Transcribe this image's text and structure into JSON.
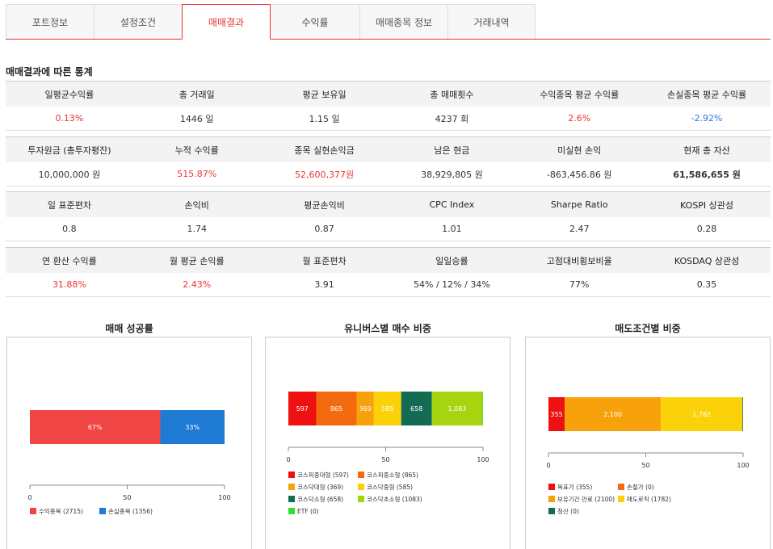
{
  "tabs": [
    {
      "label": "포트정보",
      "active": false
    },
    {
      "label": "설정조건",
      "active": false
    },
    {
      "label": "매매결과",
      "active": true
    },
    {
      "label": "수익률",
      "active": false
    },
    {
      "label": "매매종목 정보",
      "active": false
    },
    {
      "label": "거래내역",
      "active": false
    }
  ],
  "section_title": "매매결과에 따른 통계",
  "stats": [
    {
      "headers": [
        "일평균수익률",
        "총 거래일",
        "평균 보유일",
        "총 매매횟수",
        "수익종목 평균 수익률",
        "손실종목 평균 수익률"
      ],
      "values": [
        {
          "text": "0.13%",
          "color": "red"
        },
        {
          "text": "1446 일",
          "color": ""
        },
        {
          "text": "1.15 일",
          "color": ""
        },
        {
          "text": "4237 회",
          "color": ""
        },
        {
          "text": "2.6%",
          "color": "red"
        },
        {
          "text": "-2.92%",
          "color": "blue"
        }
      ]
    },
    {
      "headers": [
        "투자원금 (총투자평잔)",
        "누적 수익률",
        "종목 실현손익금",
        "남은 현금",
        "미실현 손익",
        "현재 총 자산"
      ],
      "values": [
        {
          "text": "10,000,000 원",
          "color": ""
        },
        {
          "text": "515.87%",
          "color": "red"
        },
        {
          "text": "52,600,377원",
          "color": "red"
        },
        {
          "text": "38,929,805 원",
          "color": ""
        },
        {
          "text": "-863,456.86 원",
          "color": ""
        },
        {
          "text": "61,586,655 원",
          "color": "bold"
        }
      ]
    },
    {
      "headers": [
        "일 표준편차",
        "손익비",
        "평균손익비",
        "CPC Index",
        "Sharpe Ratio",
        "KOSPI 상관성"
      ],
      "values": [
        {
          "text": "0.8",
          "color": ""
        },
        {
          "text": "1.74",
          "color": ""
        },
        {
          "text": "0.87",
          "color": ""
        },
        {
          "text": "1.01",
          "color": ""
        },
        {
          "text": "2.47",
          "color": ""
        },
        {
          "text": "0.28",
          "color": ""
        }
      ]
    },
    {
      "headers": [
        "연 환산 수익률",
        "월 평균 손익률",
        "월 표준편차",
        "일일승률",
        "고점대비횡보비율",
        "KOSDAQ 상관성"
      ],
      "values": [
        {
          "text": "31.88%",
          "color": "red"
        },
        {
          "text": "2.43%",
          "color": "red"
        },
        {
          "text": "3.91",
          "color": ""
        },
        {
          "text": "54% / 12% / 34%",
          "color": ""
        },
        {
          "text": "77%",
          "color": ""
        },
        {
          "text": "0.35",
          "color": ""
        }
      ]
    }
  ],
  "chart_data": [
    {
      "type": "bar",
      "title": "매매 성공률",
      "stacked": true,
      "xlim": [
        0,
        100
      ],
      "ticks": [
        "0",
        "50",
        "100"
      ],
      "series": [
        {
          "name": "수익종목 (2715)",
          "value": 67,
          "label": "67%",
          "color": "#f04545"
        },
        {
          "name": "손실종목 (1356)",
          "value": 33,
          "label": "33%",
          "color": "#1f7ad3"
        }
      ]
    },
    {
      "type": "bar",
      "title": "유니버스별 매수 비중",
      "stacked": true,
      "xlim": [
        0,
        100
      ],
      "ticks": [
        "0",
        "50",
        "100"
      ],
      "series": [
        {
          "name": "코스피중대형 (597)",
          "value": 597,
          "label": "597",
          "color": "#ee1111"
        },
        {
          "name": "코스피중소형 (865)",
          "value": 865,
          "label": "865",
          "color": "#f46b0f"
        },
        {
          "name": "코스닥대형 (369)",
          "value": 369,
          "label": "369",
          "color": "#f7a20b"
        },
        {
          "name": "코스닥중형 (585)",
          "value": 585,
          "label": "585",
          "color": "#fbd20a"
        },
        {
          "name": "코스닥소형 (658)",
          "value": 658,
          "label": "658",
          "color": "#126b52"
        },
        {
          "name": "코스닥초소형 (1083)",
          "value": 1083,
          "label": "1,083",
          "color": "#a6d40e"
        },
        {
          "name": "ETF (0)",
          "value": 12,
          "label": "",
          "color": "#33dd33"
        }
      ]
    },
    {
      "type": "bar",
      "title": "매도조건별 비중",
      "stacked": true,
      "xlim": [
        0,
        100
      ],
      "ticks": [
        "0",
        "50",
        "100"
      ],
      "series": [
        {
          "name": "목표가 (355)",
          "value": 355,
          "label": "355",
          "color": "#ee1111"
        },
        {
          "name": "손절가 (0)",
          "value": 0,
          "label": "",
          "color": "#f46b0f"
        },
        {
          "name": "보유기간 만료 (2100)",
          "value": 2100,
          "label": "2,100",
          "color": "#f7a20b"
        },
        {
          "name": "매도로직 (1782)",
          "value": 1782,
          "label": "1,782",
          "color": "#fbd20a"
        },
        {
          "name": "청산 (0)",
          "value": 14,
          "label": "",
          "color": "#126b52"
        }
      ]
    }
  ]
}
